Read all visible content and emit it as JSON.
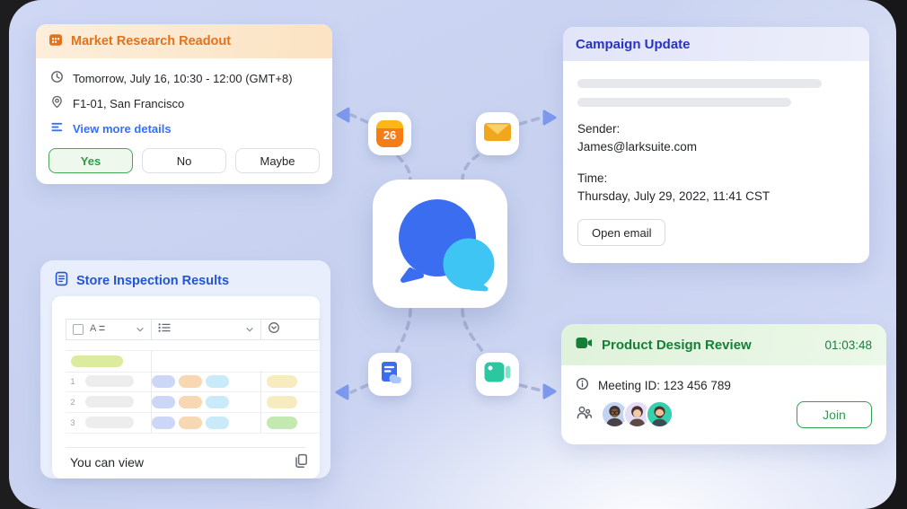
{
  "colors": {
    "accent_orange": "#e2731c",
    "accent_blue_dark": "#2733c5",
    "accent_blue": "#2155d4",
    "link_blue": "#3370ff",
    "accent_green": "#157f38",
    "bubble_blue": "#3a6df0",
    "bubble_sky": "#3fc5f3",
    "panel_bg": "#ccd5f2"
  },
  "icons": {
    "calendar_day": "26",
    "text_field_letter": "A",
    "names": [
      "calendar-grid-icon",
      "clock-icon",
      "location-pin-icon",
      "agenda-icon",
      "doc-icon",
      "mail-icon",
      "calendar-26-icon",
      "docs-cloud-icon",
      "video-camera-icon",
      "chat-bubbles-icon",
      "info-icon",
      "people-icon",
      "copy-icon",
      "checkbox",
      "chevron-down-icon"
    ]
  },
  "cards": {
    "market_research": {
      "title": "Market Research Readout",
      "time": "Tomorrow, July 16, 10:30 - 12:00 (GMT+8)",
      "location": "F1-01, San Francisco",
      "link": "View more details",
      "rsvp": {
        "yes": "Yes",
        "no": "No",
        "maybe": "Maybe"
      }
    },
    "campaign_update": {
      "title": "Campaign Update",
      "sender_label": "Sender:",
      "sender_value": "James@larksuite.com",
      "time_label": "Time:",
      "time_value": "Thursday, July 29, 2022, 11:41 CST",
      "open_button": "Open email"
    },
    "store_inspection": {
      "title": "Store Inspection Results",
      "footer": "You can view",
      "table": {
        "row_numbers": [
          "1",
          "2",
          "3"
        ]
      }
    },
    "product_design": {
      "title": "Product Design Review",
      "timer": "01:03:48",
      "meeting_id": "Meeting ID: 123 456 789",
      "join_button": "Join",
      "avatars": [
        "man-glasses",
        "woman-dark-hair",
        "man-beard"
      ]
    }
  }
}
